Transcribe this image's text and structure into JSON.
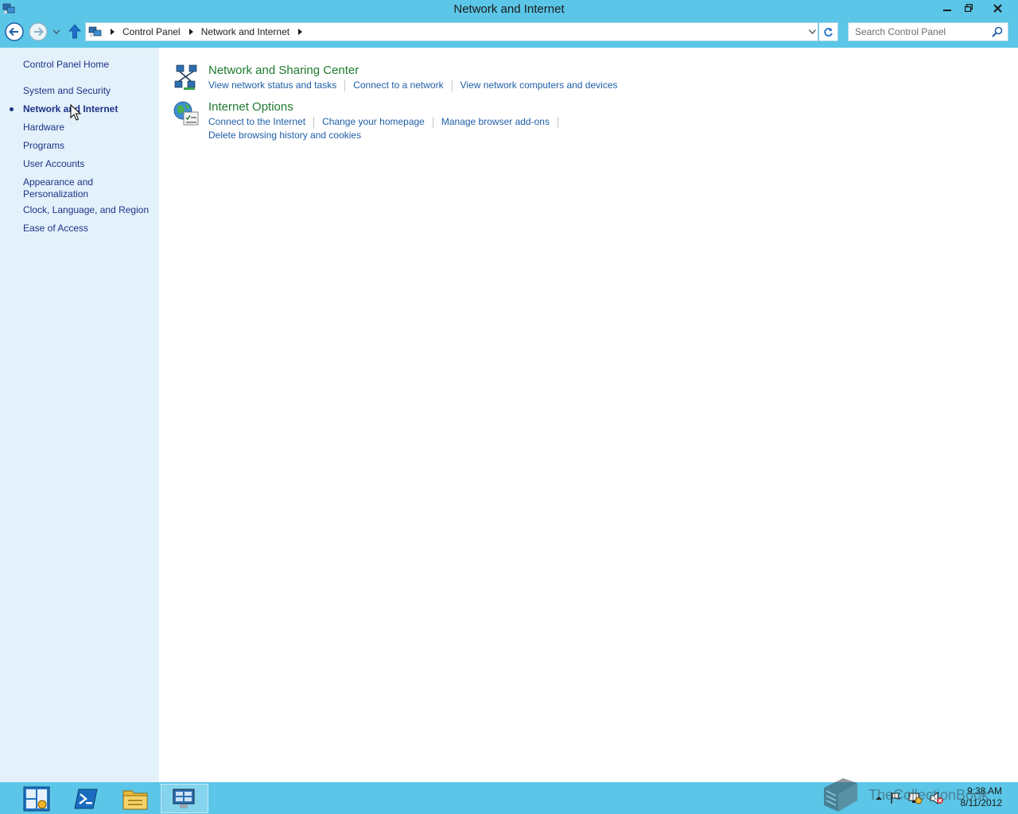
{
  "window": {
    "title": "Network and Internet",
    "app_icon": "control-panel-icon",
    "controls": [
      "minimize-icon",
      "restore-icon",
      "close-icon"
    ]
  },
  "address_bar": {
    "breadcrumbs": [
      "Control Panel",
      "Network and Internet"
    ],
    "search_placeholder": "Search Control Panel"
  },
  "sidebar": {
    "items": [
      {
        "label": "Control Panel Home",
        "active": false
      },
      {
        "label": "System and Security",
        "active": false
      },
      {
        "label": "Network and Internet",
        "active": true
      },
      {
        "label": "Hardware",
        "active": false
      },
      {
        "label": "Programs",
        "active": false
      },
      {
        "label": "User Accounts",
        "active": false
      },
      {
        "label": "Appearance and\nPersonalization",
        "active": false
      },
      {
        "label": "Clock, Language, and Region",
        "active": false
      },
      {
        "label": "Ease of Access",
        "active": false
      }
    ]
  },
  "categories": [
    {
      "title": "Network and Sharing Center",
      "icon": "network-sharing-icon",
      "links": [
        "View network status and tasks",
        "Connect to a network",
        "View network computers and devices"
      ]
    },
    {
      "title": "Internet Options",
      "icon": "internet-options-icon",
      "links": [
        "Connect to the Internet",
        "Change your homepage",
        "Manage browser add-ons"
      ],
      "links2": [
        "Delete browsing history and cookies"
      ]
    }
  ],
  "taskbar": {
    "buttons": [
      "server-manager-icon",
      "powershell-icon",
      "file-explorer-icon",
      "control-panel-icon"
    ],
    "time": "9:38 AM",
    "date": "8/11/2012"
  },
  "watermark": {
    "text": "TheCollectionBook"
  },
  "colors": {
    "chrome": "#5bc6e7",
    "sidebar": "#e3f1fb",
    "link": "#1f5ea8",
    "category_title": "#1e7a2e"
  }
}
